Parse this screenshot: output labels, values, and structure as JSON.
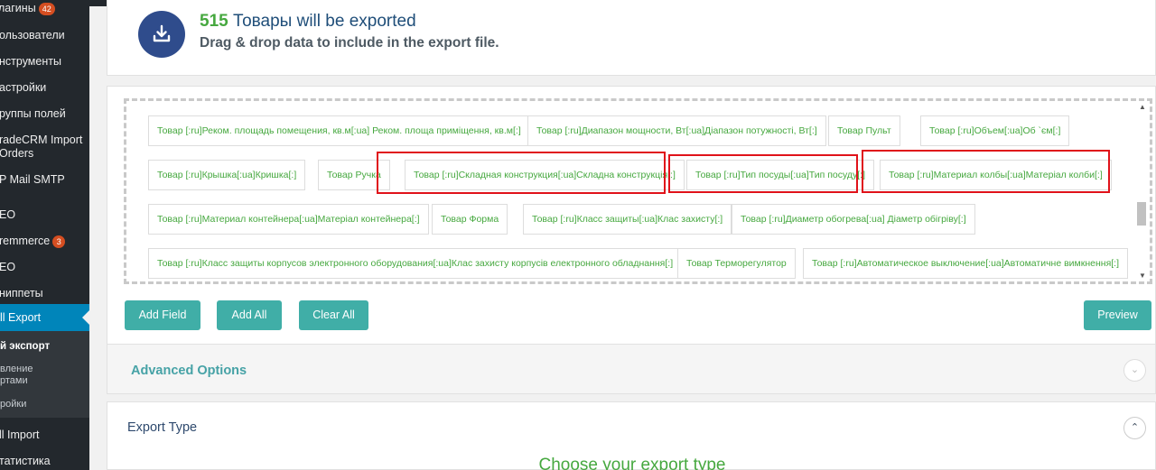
{
  "sidebar": {
    "items": [
      {
        "label": "лагины",
        "badge": "42"
      },
      {
        "label": "ользователи"
      },
      {
        "label": "нструменты"
      },
      {
        "label": "астройки"
      },
      {
        "label": "руппы полей"
      },
      {
        "label": "radeCRM Import"
      },
      {
        "label": "Orders"
      },
      {
        "label": "P Mail SMTP"
      },
      {
        "label": "EO"
      },
      {
        "label": "remmerce",
        "badge": "3"
      },
      {
        "label": "EO"
      },
      {
        "label": "ниппеты"
      },
      {
        "label": "ll Export"
      },
      {
        "label": "й экспорт"
      },
      {
        "label": "вление"
      },
      {
        "label": "ртами"
      },
      {
        "label": "ройки"
      },
      {
        "label": "ll Import"
      },
      {
        "label": "татистика"
      }
    ]
  },
  "header": {
    "count": "515",
    "title_rest": " Товары will be exported",
    "subtitle": "Drag & drop data to include in the export file."
  },
  "fields": [
    "Товар [:ru]Реком. площадь помещения, кв.м[:ua] Реком. площа приміщення, кв.м[:]",
    "Товар [:ru]Диапазон мощности, Вт[:ua]Діапазон потужності, Вт[:]",
    "Товар Пульт",
    "Товар [:ru]Объем[:ua]Об `єм[:]",
    "Товар [:ru]Крышка[:ua]Кришка[:]",
    "Товар Ручка",
    "Товар [:ru]Складная конструкция[:ua]Складна конструкція[:]",
    "Товар [:ru]Тип посуды[:ua]Тип посуду[:]",
    "Товар [:ru]Материал колбы[:ua]Матеріал колби[:]",
    "Товар [:ru]Материал контейнера[:ua]Матеріал контейнера[:]",
    "Товар Форма",
    "Товар [:ru]Класс защиты[:ua]Клас захисту[:]",
    "Товар [:ru]Диаметр обогрева[:ua] Діаметр обігріву[:]",
    "Товар [:ru]Класс защиты корпусов электронного оборудования[:ua]Клас захисту корпусів електронного обладнання[:]",
    "Товар Терморегулятор",
    "Товар [:ru]Автоматическое выключение[:ua]Автоматичне вимкнення[:]"
  ],
  "buttons": {
    "add_field": "Add Field",
    "add_all": "Add All",
    "clear_all": "Clear All",
    "preview": "Preview"
  },
  "advanced": {
    "title": "Advanced Options"
  },
  "export_type": {
    "title": "Export Type",
    "choose": "Choose your export type"
  },
  "icons": {
    "export": "download-tray-icon",
    "advanced_toggle": "chevron-down-icon",
    "type_toggle": "chevron-up-icon",
    "active_menu_arrow": "menu-arrow-icon"
  },
  "colors": {
    "sidebar_bg": "#23282d",
    "active_menu": "#0085ba",
    "field_text": "#46a83f",
    "button": "#40aea7",
    "highlight": "#e0121a",
    "title": "#1f4e79"
  }
}
